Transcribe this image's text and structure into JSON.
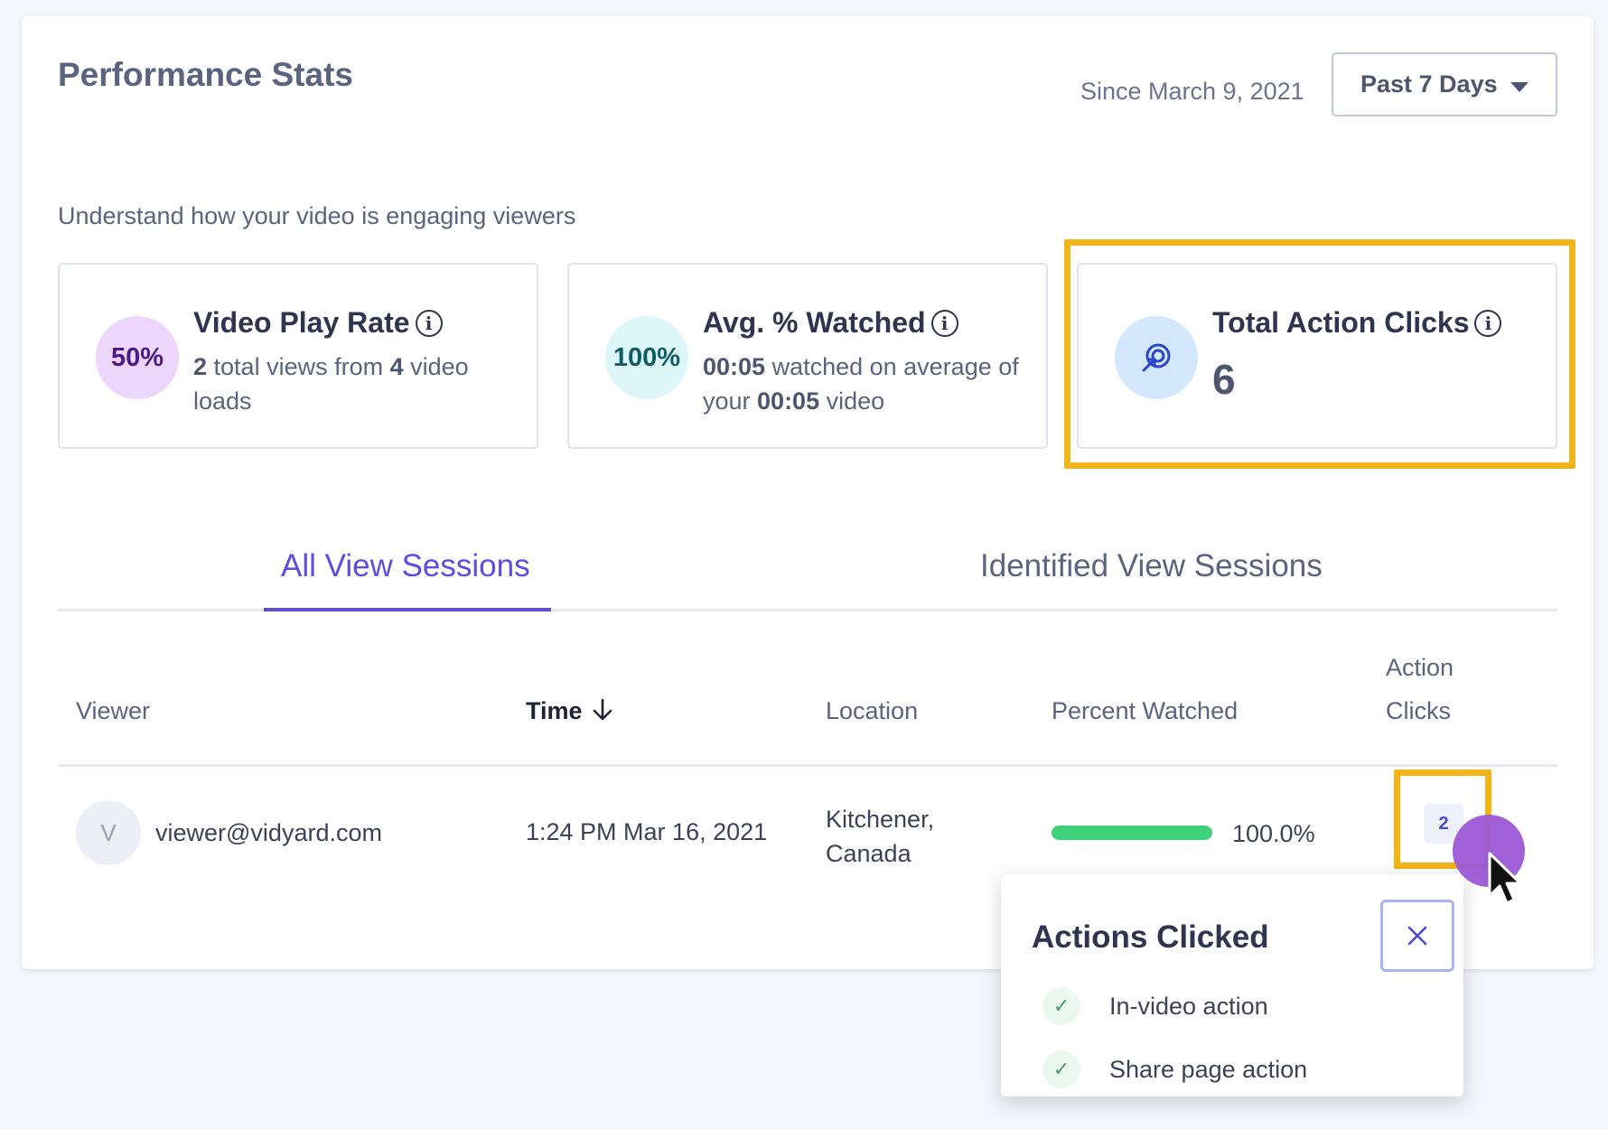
{
  "header": {
    "title": "Performance Stats",
    "since": "Since March 9, 2021",
    "range": "Past 7 Days",
    "subtitle": "Understand how your video is engaging viewers"
  },
  "cards": [
    {
      "badge": "50%",
      "title": "Video Play Rate",
      "desc": [
        "2",
        " total views from ",
        "4",
        " video loads"
      ],
      "badge_bg": "#ecd6fb",
      "badge_color": "#4b1a86"
    },
    {
      "badge": "100%",
      "title": "Avg. % Watched",
      "desc": [
        "00:05",
        " watched on average of your ",
        "00:05",
        " video"
      ],
      "badge_bg": "#ddf7f8",
      "badge_color": "#115b66"
    },
    {
      "title": "Total Action Clicks",
      "value": "6",
      "icon": "target-click-icon",
      "badge_bg": "#d3e8fd"
    }
  ],
  "tabs": [
    {
      "label": "All View Sessions",
      "active": true
    },
    {
      "label": "Identified View Sessions",
      "active": false
    }
  ],
  "table": {
    "columns": [
      "Viewer",
      "Time",
      "Location",
      "Percent Watched",
      "Action",
      "Clicks"
    ],
    "sort_icon": "arrow-down-icon",
    "rows": [
      {
        "avatar": "V",
        "viewer": "viewer@vidyard.com",
        "time": "1:24 PM Mar 16, 2021",
        "location_1": "Kitchener,",
        "location_2": "Canada",
        "percent": 100,
        "percent_label": "100.0%",
        "action_clicks": "2"
      }
    ]
  },
  "popover": {
    "title": "Actions Clicked",
    "close_icon": "close-icon",
    "items": [
      "In-video action",
      "Share page action"
    ]
  },
  "colors": {
    "accent": "#5f4de0",
    "highlight": "#f2b418",
    "progress": "#3fd07a"
  }
}
